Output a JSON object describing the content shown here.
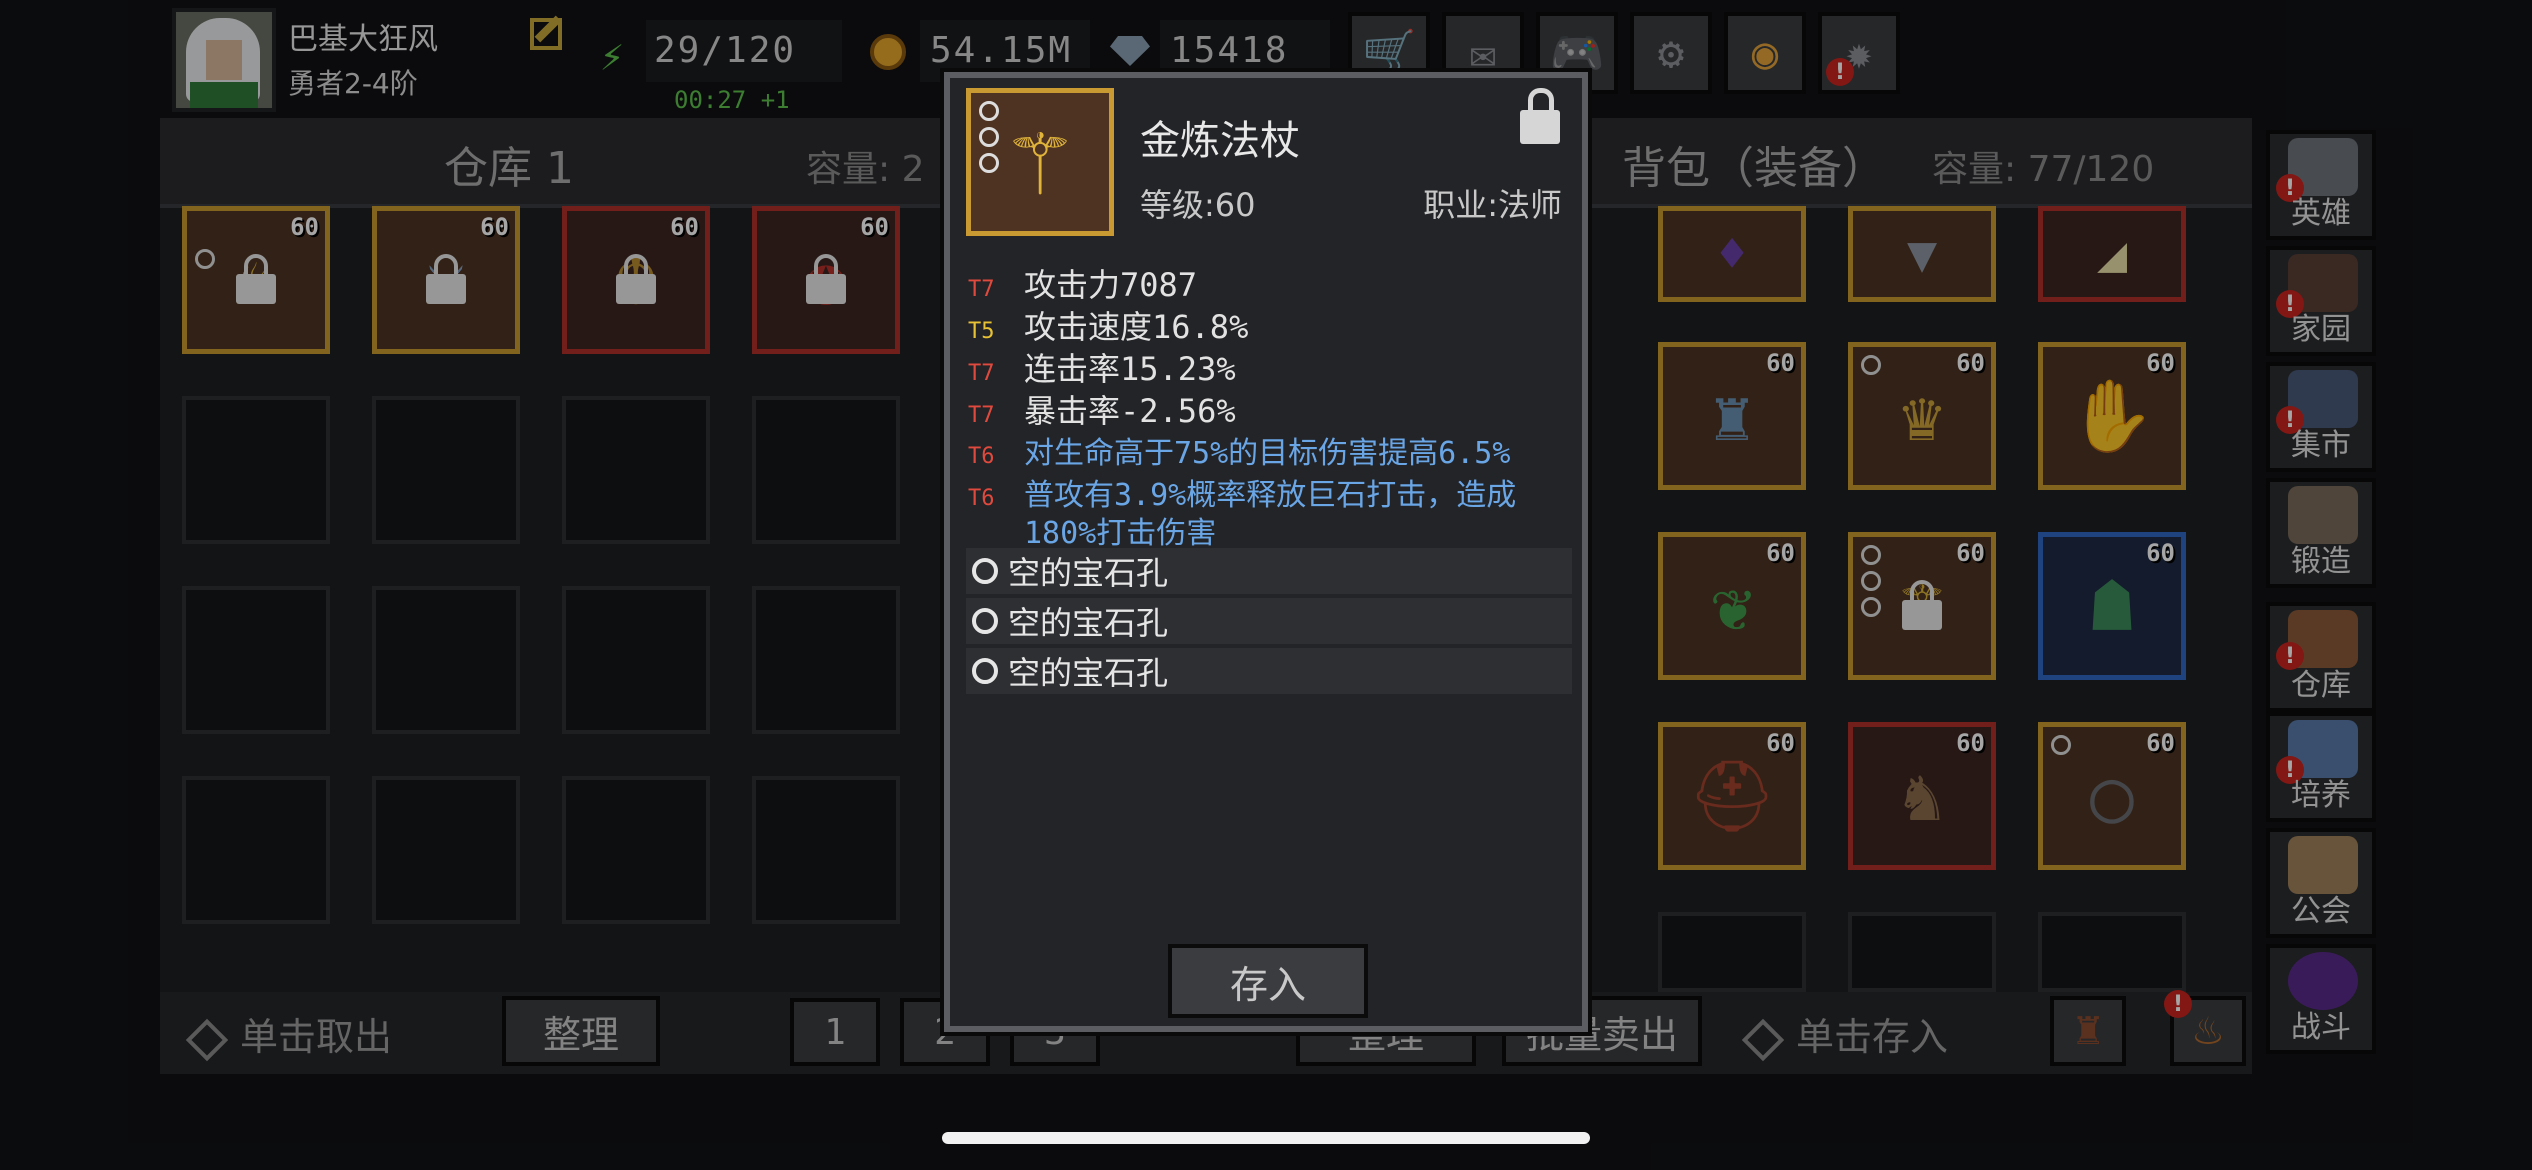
{
  "player": {
    "name": "巴基大狂风",
    "rank": "勇者2-4阶"
  },
  "resources": {
    "energy": "29/120",
    "energy_timer": "00:27 +1",
    "gold": "54.15M",
    "gems": "15418"
  },
  "top_buttons": [
    "shop",
    "mail",
    "gamepad",
    "settings",
    "gacha",
    "event"
  ],
  "warehouse": {
    "title": "仓库 1",
    "capacity_label": "容量: 2"
  },
  "bag": {
    "title": "背包（装备）",
    "capacity_label": "容量: 77/120"
  },
  "warehouse_items": [
    {
      "level": "60",
      "type": "lamp",
      "locked": true
    },
    {
      "level": "60",
      "type": "sword",
      "locked": true
    },
    {
      "level": "60",
      "type": "demon-amulet",
      "locked": true
    },
    {
      "level": "60",
      "type": "red-amulet",
      "locked": true
    }
  ],
  "bag_items": [
    {
      "level": "60",
      "type": "armor"
    },
    {
      "level": "60",
      "type": "helmet"
    },
    {
      "level": "60",
      "type": "gloves"
    },
    {
      "level": "60",
      "type": "necklace"
    },
    {
      "level": "60",
      "type": "staff"
    },
    {
      "level": "60",
      "type": "green-helmet"
    },
    {
      "level": "60",
      "type": "hat"
    },
    {
      "level": "60",
      "type": "pants"
    },
    {
      "level": "60",
      "type": "ring"
    }
  ],
  "bottom_left": {
    "hint": "单击取出",
    "sort": "整理",
    "pages": [
      "1",
      "2",
      "3"
    ]
  },
  "bottom_right": {
    "sort": "整理",
    "bulk_sell": "批量卖出",
    "hint": "单击存入"
  },
  "sidebar": [
    "英雄",
    "家园",
    "集市",
    "锻造",
    "仓库",
    "培养",
    "公会",
    "战斗"
  ],
  "tooltip": {
    "name": "金炼法杖",
    "level": "等级:60",
    "class": "职业:法师",
    "attributes": [
      {
        "tier": "T7",
        "text": "攻击力7087"
      },
      {
        "tier": "T5",
        "text": "攻击速度16.8%"
      },
      {
        "tier": "T7",
        "text": "连击率15.23%"
      },
      {
        "tier": "T7",
        "text": "暴击率-2.56%"
      },
      {
        "tier": "T6",
        "text": "对生命高于75%的目标伤害提高6.5%"
      },
      {
        "tier": "T6",
        "text": "普攻有3.9%概率释放巨石打击，造成"
      }
    ],
    "attr_wrap": "180%打击伤害",
    "sockets": [
      "空的宝石孔",
      "空的宝石孔",
      "空的宝石孔"
    ],
    "deposit": "存入"
  },
  "colors": {
    "tier_red": "#e04a3e",
    "tier_yellow": "#e7c235",
    "effect_blue": "#6aa6e6",
    "frame_gold": "#c99a31"
  }
}
